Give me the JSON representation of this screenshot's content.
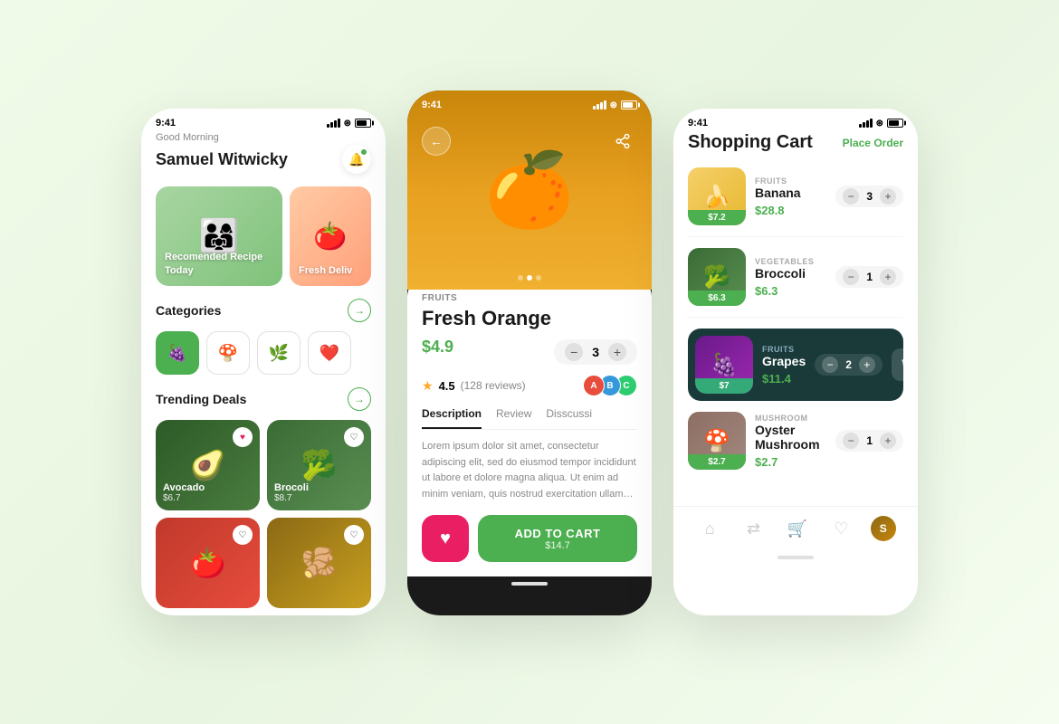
{
  "app": {
    "screen1": {
      "status_time": "9:41",
      "greeting": "Good Morning",
      "user_name": "Samuel Witwicky",
      "banner1_label": "Recomended Recipe Today",
      "banner2_label": "Fresh Deliv",
      "categories_title": "Categories",
      "trending_title": "Trending Deals",
      "avocado_name": "Avocado",
      "avocado_price": "$6.7",
      "broccoli_name": "Brocoli",
      "broccoli_price": "$8.7"
    },
    "screen2": {
      "status_time": "9:41",
      "category": "FRUITS",
      "product_name": "Fresh Orange",
      "price": "$4.9",
      "quantity": "3",
      "rating": "4.5",
      "review_count": "(128 reviews)",
      "tab_description": "Description",
      "tab_review": "Review",
      "tab_discussion": "Disscussi",
      "description": "Lorem ipsum dolor sit amet, consectetur adipiscing elit, sed do eiusmod tempor incididunt ut labore et dolore magna aliqua. Ut enim ad minim veniam, quis nostrud exercitation ullamco laboris nisi ut aliquip ex",
      "add_to_cart": "ADD TO CART",
      "cart_price": "$14.7"
    },
    "screen3": {
      "status_time": "9:41",
      "title": "Shopping Cart",
      "place_order": "Place Order",
      "items": [
        {
          "category": "FRUITS",
          "name": "Banana",
          "badge_price": "$7.2",
          "price": "$28.8",
          "qty": "3",
          "emoji": "🍌"
        },
        {
          "category": "VEGETABLES",
          "name": "Broccoli",
          "badge_price": "$6.3",
          "price": "$6.3",
          "qty": "1",
          "emoji": "🥦"
        },
        {
          "category": "FRUITS",
          "name": "Grapes",
          "badge_price": "$7",
          "price": "$11.4",
          "qty": "2",
          "emoji": "🍇",
          "selected": true
        },
        {
          "category": "MUSHROOM",
          "name": "Oyster Mushroom",
          "badge_price": "$2.7",
          "price": "$2.7",
          "qty": "1",
          "emoji": "🍄"
        }
      ]
    }
  }
}
